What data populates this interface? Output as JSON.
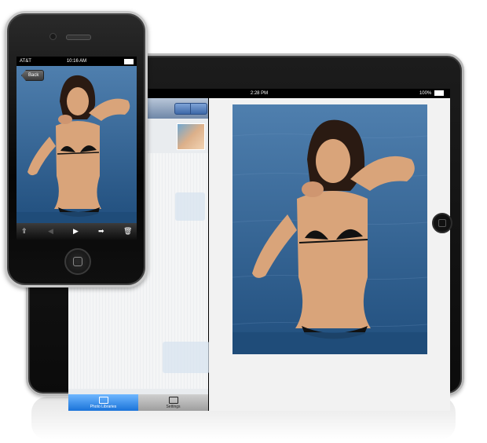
{
  "ipad": {
    "status": {
      "time": "2:28 PM",
      "battery": "100%"
    },
    "master": {
      "tabs": [
        {
          "label": "Photo Libraries",
          "active": true
        },
        {
          "label": "Settings",
          "active": false
        }
      ]
    }
  },
  "iphone": {
    "status": {
      "carrier": "AT&T",
      "time": "10:16 AM"
    },
    "nav": {
      "back_label": "Back"
    },
    "toolbar": {
      "action_icon": "share-icon",
      "prev_icon": "arrow-left-icon",
      "play_icon": "play-icon",
      "next_icon": "arrow-right-icon",
      "delete_icon": "trash-icon"
    }
  },
  "colors": {
    "device_bezel": "#0b0b0b",
    "active_tab": "#1a73d9",
    "water": "#2c5f8e",
    "skin": "#d9a47a"
  }
}
